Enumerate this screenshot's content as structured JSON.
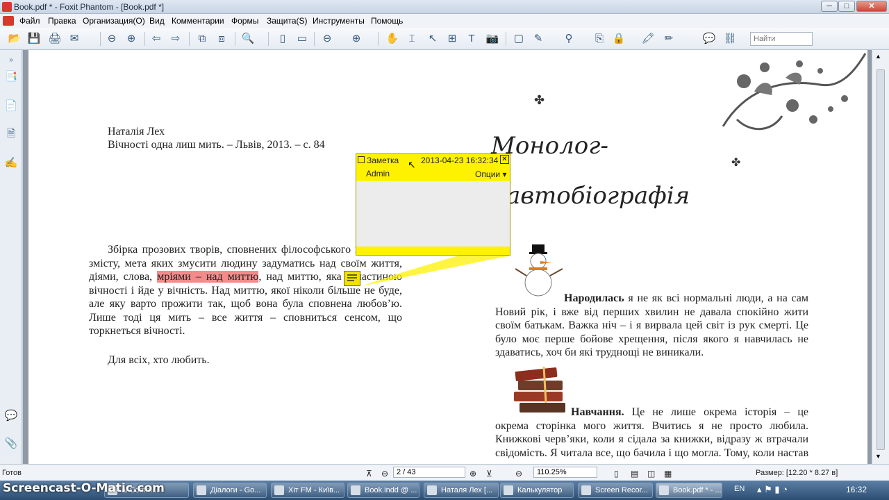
{
  "window": {
    "title": "Book.pdf * - Foxit Phantom - [Book.pdf *]",
    "min": "─",
    "max": "□",
    "close": "✕"
  },
  "menu": [
    "Файл",
    "Правка",
    "Организация(O)",
    "Вид",
    "Комментарии",
    "Формы",
    "Защита(S)",
    "Инструменты",
    "Помощь"
  ],
  "toolbar": {
    "search_placeholder": "Найти"
  },
  "page_left": {
    "author": "Наталія Лех",
    "citation": "Вічності одна лиш мить. – Львів, 2013. –  с. 84",
    "para1_a": "Збірка прозових творів, сповнених філософського глибокого змісту, мета яких змусити людину задуматись над своїм життя, діями, слова, ",
    "para1_hl": "мріями – над миттю",
    "para1_b": ", над миттю, яка є частиною вічності і йде у вічність. Над миттю, якої ніколи більше не буде, але яку варто прожити так, щоб вона була сповнена любов’ю. Лише тоді ця мить – все життя – сповниться сенсом, що торкнеться вічності.",
    "dedication": "Для всіх, хто любить."
  },
  "page_right": {
    "heading1": "Монолог-",
    "heading2": "автобіографія",
    "born_bold": "Народилась",
    "born_text": " я не як всі нормальні люди, а на сам Новий рік, і вже від перших хвилин не давала спокійно жити своїм батькам. Важка ніч – і я вирвала цей світ із рук смерті. Це було моє перше бойове хрещення, після якого я навчилась не здаватись, хоч би які труднощі не виникали.",
    "study_bold": "Навчання.",
    "study_text": " Це не лише окрема історія – це окрема сторінка мого життя. Вчитись я не просто любила. Книжкові черв’яки, коли я сідала за книжки, відразу ж втрачали свідомість. Я читала все, що бачила і що могла. Тому, коли настав час"
  },
  "note": {
    "title": "Заметка",
    "datetime": "2013-04-23 16:32:34",
    "author": "Admin",
    "options": "Опции ▾",
    "close": "✕"
  },
  "status": {
    "ready": "Готов",
    "page": "2 / 43",
    "zoom": "110.25%",
    "size": "Размер: [12.20 * 8.27 в]"
  },
  "taskbar": {
    "watermark": "Screencast-O-Matic.com",
    "items": [
      "al Comm...",
      "Діалоги - Go...",
      "Хіт FM - Київ...",
      "Book.indd @ ...",
      "Наталя Лех [...",
      "Калькулятор",
      "Screen Recor...",
      "Book.pdf * - ..."
    ],
    "lang": "EN",
    "clock": "16:32"
  }
}
